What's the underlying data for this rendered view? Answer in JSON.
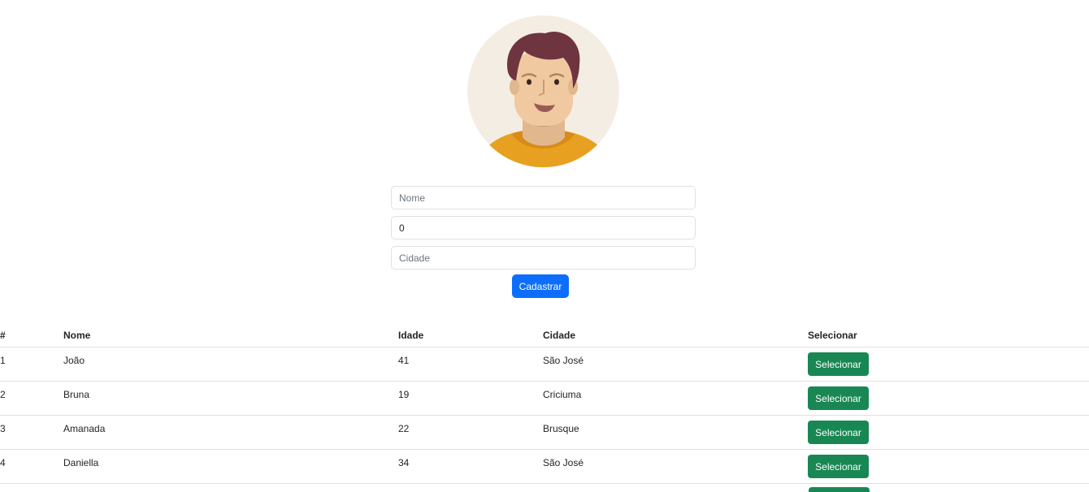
{
  "avatar": {
    "icon": "user-avatar-icon"
  },
  "form": {
    "nome": {
      "placeholder": "Nome",
      "value": ""
    },
    "idade": {
      "placeholder": "",
      "value": "0"
    },
    "cidade": {
      "placeholder": "Cidade",
      "value": ""
    },
    "submit_label": "Cadastrar"
  },
  "table": {
    "headers": [
      "#",
      "Nome",
      "Idade",
      "Cidade",
      "Selecionar"
    ],
    "rows": [
      {
        "id": "1",
        "nome": "João",
        "idade": "41",
        "cidade": "São José",
        "action": "Selecionar"
      },
      {
        "id": "2",
        "nome": "Bruna",
        "idade": "19",
        "cidade": "Criciuma",
        "action": "Selecionar"
      },
      {
        "id": "3",
        "nome": "Amanada",
        "idade": "22",
        "cidade": "Brusque",
        "action": "Selecionar"
      },
      {
        "id": "4",
        "nome": "Daniella",
        "idade": "34",
        "cidade": "São José",
        "action": "Selecionar"
      }
    ]
  },
  "colors": {
    "primary": "#0d6efd",
    "success": "#198754",
    "border": "#dee2e6"
  }
}
